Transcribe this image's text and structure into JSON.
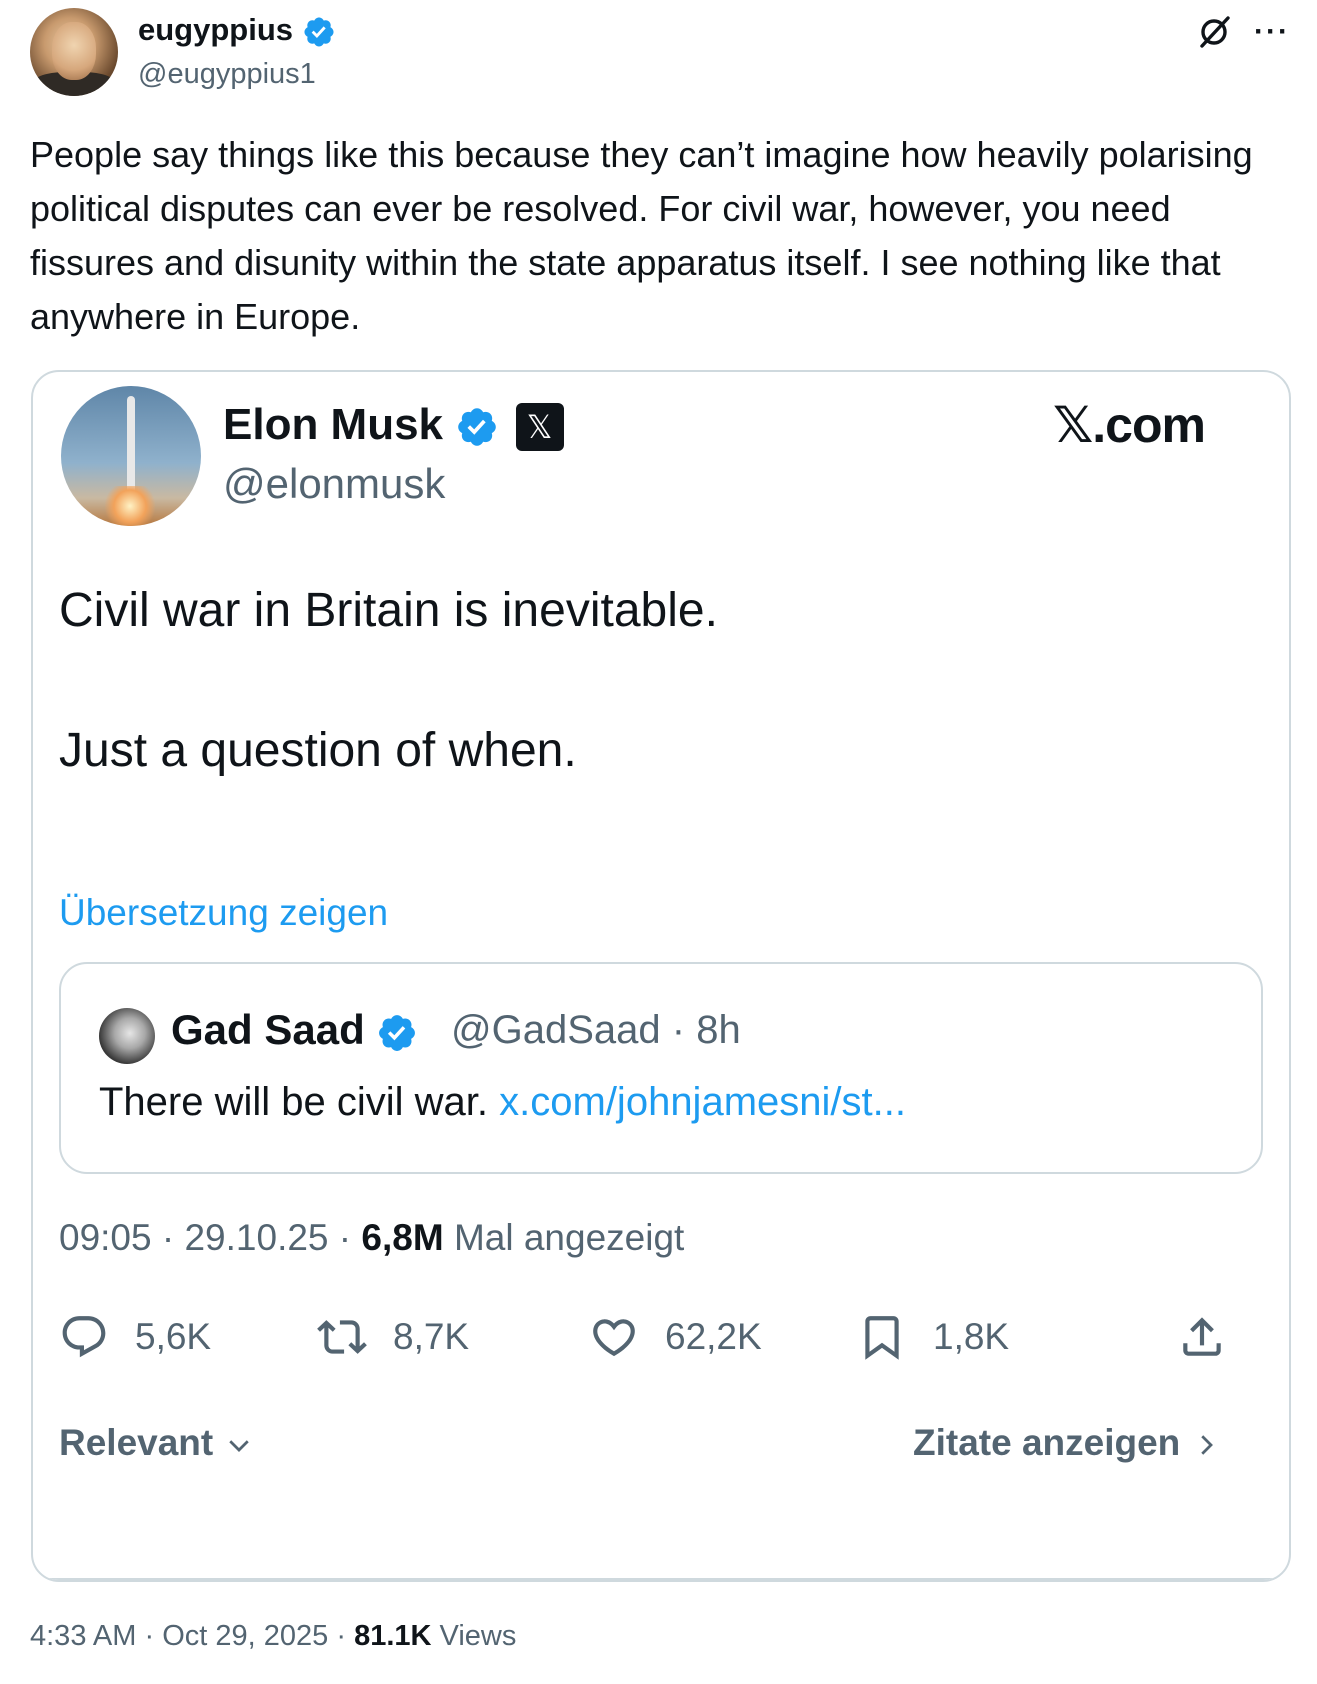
{
  "author": {
    "name": "eugyppius",
    "handle": "@eugyppius1"
  },
  "tweet": {
    "text": "People say things like this because they can’t imagine how heavily polarising political disputes can ever be resolved. For civil war, however, you need fissures and disunity within the state apparatus itself. I see nothing like that anywhere in Europe."
  },
  "embed": {
    "name": "Elon Musk",
    "x_badge": "𝕏",
    "handle": "@elonmusk",
    "site_logo": "𝕏.com",
    "text_lines": [
      "Civil war in Britain is inevitable.",
      "Just a question of when."
    ],
    "translate_label": "Übersetzung zeigen",
    "quoted": {
      "name": "Gad Saad",
      "handle": "@GadSaad",
      "separator": "·",
      "age": "8h",
      "text": "There will be civil war.",
      "link": "x.com/johnjamesni/st..."
    },
    "meta": {
      "time": "09:05",
      "separator": "·",
      "date": "29.10.25",
      "views": "6,8M",
      "views_label": "Mal angezeigt"
    },
    "actions": {
      "replies": "5,6K",
      "reposts": "8,7K",
      "likes": "62,2K",
      "bookmarks": "1,8K"
    },
    "sort_label": "Relevant",
    "quotes_label": "Zitate anzeigen"
  },
  "footer": {
    "time": "4:33 AM",
    "separator": "·",
    "date": "Oct 29, 2025",
    "views": "81.1K",
    "views_label": "Views"
  },
  "colors": {
    "accent": "#1d9bf0",
    "secondary_text": "#536471",
    "primary_text": "#0f1419",
    "border": "#cfd9de"
  },
  "icons": [
    "verified-badge-icon",
    "grok-icon",
    "more-icon",
    "reply-icon",
    "repost-icon",
    "like-icon",
    "bookmark-icon",
    "share-icon",
    "chevron-down-icon",
    "chevron-right-icon"
  ]
}
